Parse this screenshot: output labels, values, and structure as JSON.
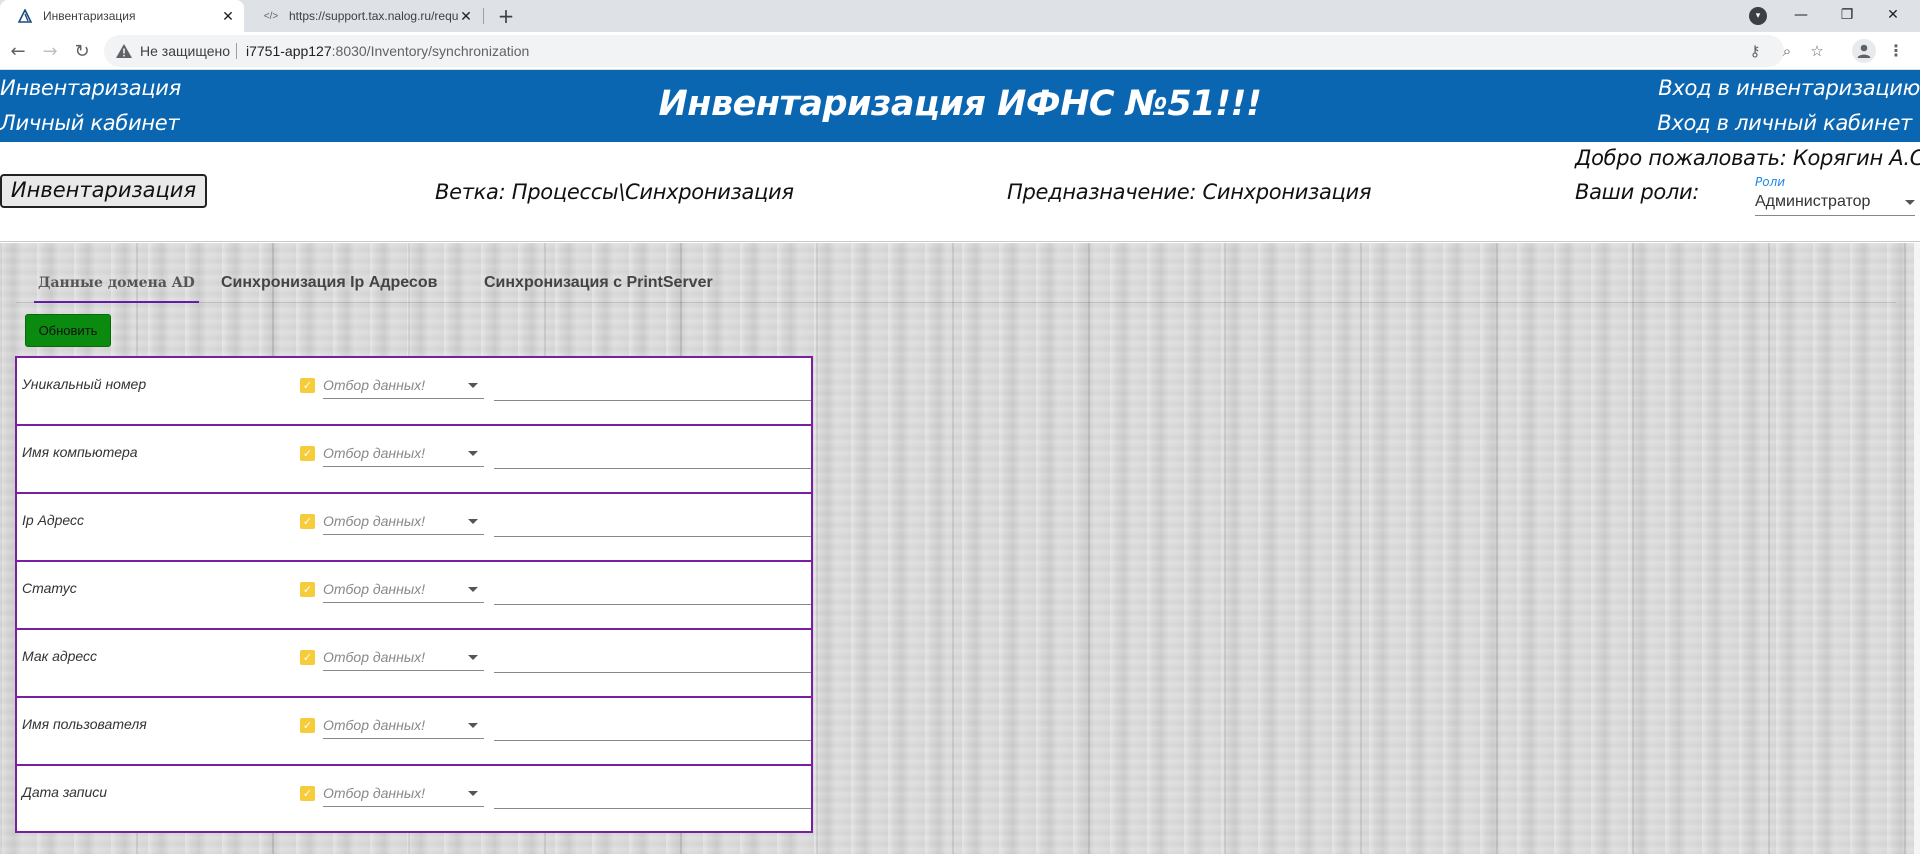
{
  "browser": {
    "tabs": [
      {
        "title": "Инвентаризация",
        "active": true
      },
      {
        "title": "https://support.tax.nalog.ru/requ",
        "active": false
      }
    ],
    "new_tab": "+",
    "omnibox": {
      "security": "Не защищено",
      "host": "i7751-app127",
      "path": ":8030/Inventory/synchronization"
    },
    "icons": [
      "back-icon",
      "forward-icon",
      "reload-icon",
      "warning-icon",
      "key-icon",
      "zoom-icon",
      "star-icon",
      "profile-icon",
      "menu-icon",
      "tab-search-icon",
      "minimize-icon",
      "restore-icon",
      "close-icon"
    ]
  },
  "header": {
    "left_links": [
      "Инвентаризация",
      "Личный кабинет"
    ],
    "title": "Инвентаризация ИФНС №51!!!",
    "right_links": [
      "Вход в инвентаризацию",
      "Вход в личный кабинет"
    ],
    "background_color": "#0a66b0"
  },
  "info": {
    "inventory_button": "Инвентаризация",
    "branch": "Ветка: Процессы\\Синхронизация",
    "purpose": "Предназначение: Синхронизация",
    "welcome": "Добро пожаловать: Корягин А.С.",
    "roles_label": "Ваши роли:",
    "roles_field_label": "Роли",
    "roles_value": "Администратор"
  },
  "content": {
    "tabs": [
      "Данные домена AD",
      "Синхронизация Ip Адресов",
      "Синхронизация с PrintServer"
    ],
    "active_tab": 0,
    "refresh_button": "Обновить",
    "refresh_color": "#0b8a10",
    "filter_placeholder": "Отбор данных!",
    "filters": [
      {
        "label": "Уникальный номер",
        "checked": true
      },
      {
        "label": "Имя компьютера",
        "checked": true
      },
      {
        "label": "Ip Адресс",
        "checked": true
      },
      {
        "label": "Статус",
        "checked": true
      },
      {
        "label": "Мак адресс",
        "checked": true
      },
      {
        "label": "Имя пользователя",
        "checked": true
      },
      {
        "label": "Дата записи",
        "checked": true
      }
    ],
    "accent_color": "#7b1fa2",
    "checkbox_color": "#f6cc3a"
  }
}
